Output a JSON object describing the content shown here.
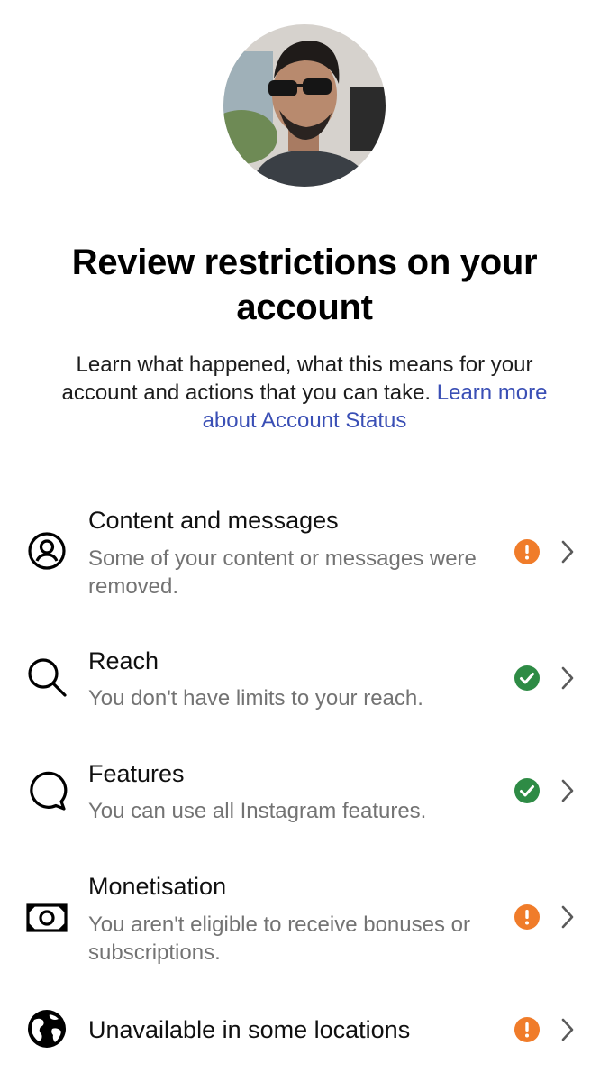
{
  "header": {
    "title": "Review restrictions on your account",
    "description": "Learn what happened, what this means for your account and actions that you can take.",
    "link_text": "Learn more about Account Status"
  },
  "colors": {
    "link": "#3a4fb5",
    "warning": "#f07c2a",
    "ok": "#2e8b45",
    "secondary_text": "#737373"
  },
  "items": [
    {
      "icon": "user-circle-icon",
      "title": "Content and messages",
      "description": "Some of your content or messages were removed.",
      "status": "warning"
    },
    {
      "icon": "search-icon",
      "title": "Reach",
      "description": "You don't have limits to your reach.",
      "status": "ok"
    },
    {
      "icon": "speech-bubble-icon",
      "title": "Features",
      "description": "You can use all Instagram features.",
      "status": "ok"
    },
    {
      "icon": "money-icon",
      "title": "Monetisation",
      "description": "You aren't eligible to receive bonuses or subscriptions.",
      "status": "warning"
    },
    {
      "icon": "globe-icon",
      "title": "Unavailable in some locations",
      "description": "",
      "status": "warning"
    }
  ]
}
